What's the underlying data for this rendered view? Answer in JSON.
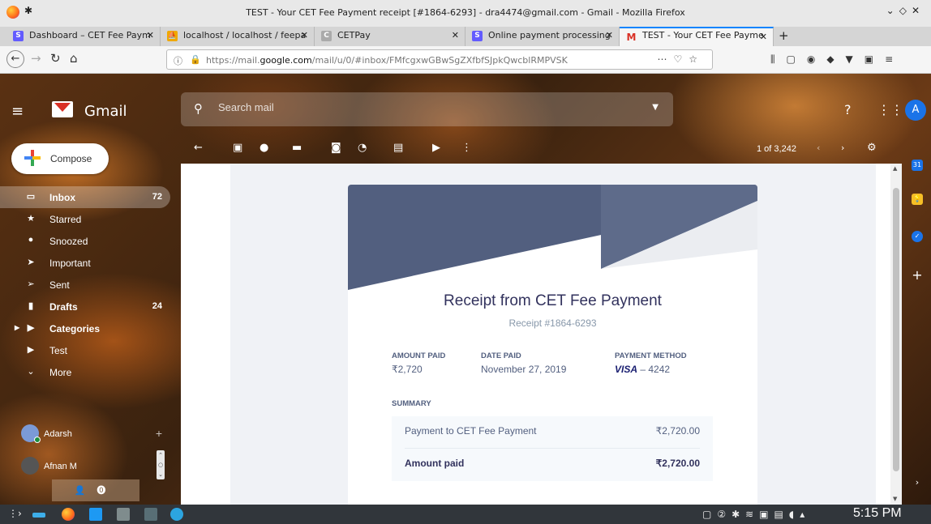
{
  "window": {
    "title": "TEST - Your CET Fee Payment receipt [#1864-6293] - dra4474@gmail.com - Gmail - Mozilla Firefox"
  },
  "tabs": [
    {
      "label": "Dashboard – CET Fee Paym",
      "favicon": "stripe-s"
    },
    {
      "label": "localhost / localhost / feepa",
      "favicon": "phpmyadmin"
    },
    {
      "label": "CETPay",
      "favicon": "cetpay"
    },
    {
      "label": "Online payment processing",
      "favicon": "stripe-s"
    },
    {
      "label": "TEST - Your CET Fee Payme",
      "favicon": "gmail-m"
    }
  ],
  "address_bar": {
    "url_prefix": "https://mail.",
    "url_domain": "google.com",
    "url_path": "/mail/u/0/#inbox/FMfcgxwGBwSgZXfbfSJpkQwcblRMPVSK"
  },
  "gmail": {
    "app_name": "Gmail",
    "search_placeholder": "Search mail",
    "avatar_letter": "A",
    "compose_label": "Compose",
    "pager_text": "1 of 3,242",
    "nav": [
      {
        "label": "Inbox",
        "count": "72",
        "icon": "inbox-icon"
      },
      {
        "label": "Starred",
        "count": "",
        "icon": "star-icon"
      },
      {
        "label": "Snoozed",
        "count": "",
        "icon": "clock-icon"
      },
      {
        "label": "Important",
        "count": "",
        "icon": "important-icon"
      },
      {
        "label": "Sent",
        "count": "",
        "icon": "send-icon"
      },
      {
        "label": "Drafts",
        "count": "24",
        "icon": "draft-icon"
      },
      {
        "label": "Categories",
        "count": "",
        "icon": "label-icon"
      },
      {
        "label": "Test",
        "count": "",
        "icon": "label-icon"
      },
      {
        "label": "More",
        "count": "",
        "icon": "chevron-down-icon"
      }
    ],
    "hangouts": [
      {
        "name": "Adarsh"
      },
      {
        "name": "Afnan M"
      }
    ]
  },
  "receipt": {
    "title": "Receipt from CET Fee Payment",
    "number": "Receipt #1864-6293",
    "amount_paid_label": "AMOUNT PAID",
    "amount_paid": "₹2,720",
    "date_paid_label": "DATE PAID",
    "date_paid": "November 27, 2019",
    "payment_method_label": "PAYMENT METHOD",
    "card_brand": "VISA",
    "card_last4": "– 4242",
    "summary_label": "SUMMARY",
    "line_item_label": "Payment to CET Fee Payment",
    "line_item_amount": "₹2,720.00",
    "total_label": "Amount paid",
    "total_amount": "₹2,720.00"
  },
  "taskbar": {
    "clock": "5:15 PM"
  },
  "colors": {
    "tab_accent": "#0a84ff",
    "gmail_red": "#d93025",
    "receipt_header": "#525f7f",
    "receipt_title": "#32325d"
  }
}
